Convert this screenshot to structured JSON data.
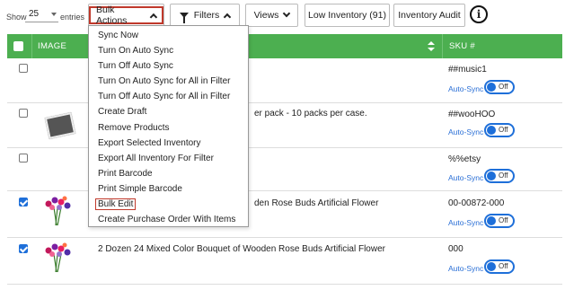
{
  "toolbar": {
    "show_label": "Show",
    "page_size": "25",
    "entries_label": "entries",
    "bulk_actions": "Bulk Actions",
    "filters": "Filters",
    "views": "Views",
    "low_inventory": "Low Inventory (91)",
    "inventory_audit": "Inventory Audit",
    "info_glyph": "i"
  },
  "bulk_menu": {
    "items": [
      "Sync Now",
      "Turn On Auto Sync",
      "Turn Off Auto Sync",
      "Turn On Auto Sync for All in Filter",
      "Turn Off Auto Sync for All in Filter",
      "Create Draft",
      "Remove Products",
      "Export Selected Inventory",
      "Export All Inventory For Filter",
      "Print Barcode",
      "Print Simple Barcode",
      "Bulk Edit",
      "Create Purchase Order With Items"
    ],
    "highlighted_item": "Bulk Edit"
  },
  "table": {
    "headers": {
      "image": "IMAGE",
      "sku": "SKU #"
    },
    "rows": [
      {
        "checked": false,
        "name": "",
        "sku": "##music1",
        "autosync_label": "Auto-Sync",
        "toggle": "Off",
        "image": "none"
      },
      {
        "checked": false,
        "name": "er pack - 10 packs per case.",
        "sku": "##wooHOO",
        "autosync_label": "Auto-Sync",
        "toggle": "Off",
        "image": "photo"
      },
      {
        "checked": false,
        "name": "",
        "sku": "%%etsy",
        "autosync_label": "Auto-Sync",
        "toggle": "Off",
        "image": "none"
      },
      {
        "checked": true,
        "name": "den Rose Buds Artificial Flower",
        "sku": "00-00872-000",
        "autosync_label": "Auto-Sync",
        "toggle": "Off",
        "image": "flowers"
      },
      {
        "checked": true,
        "name": "2 Dozen 24 Mixed Color Bouquet of Wooden Rose Buds Artificial Flower",
        "sku": "000",
        "autosync_label": "Auto-Sync",
        "toggle": "Off",
        "image": "flowers"
      }
    ]
  },
  "colors": {
    "header_green": "#4caf50",
    "accent_blue": "#1e6fd9",
    "highlight_red": "#c0392b"
  }
}
